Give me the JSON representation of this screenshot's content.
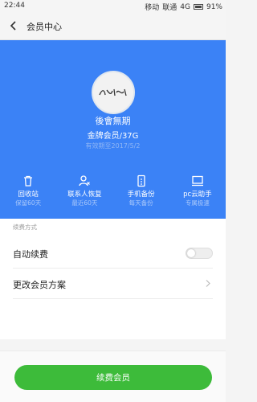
{
  "status_bar": {
    "time": "22:44",
    "carrier_1": "移动",
    "carrier_2": "联通",
    "network": "4G",
    "battery": "91%"
  },
  "nav": {
    "title": "会员中心",
    "back_icon": "chevron-left-icon"
  },
  "profile": {
    "avatar_text": "后会无期",
    "name": "後會無期",
    "level": "金牌会员/37G",
    "expire": "有效期至2017/5/2"
  },
  "features": [
    {
      "icon": "trash-icon",
      "label": "回收站",
      "sub": "保留60天"
    },
    {
      "icon": "contacts-icon",
      "label": "联系人恢复",
      "sub": "最近60天"
    },
    {
      "icon": "phone-backup-icon",
      "label": "手机备份",
      "sub": "每天备份"
    },
    {
      "icon": "pc-icon",
      "label": "pc云助手",
      "sub": "专属极速"
    }
  ],
  "settings": {
    "section_title": "续费方式",
    "auto_renew_label": "自动续费",
    "auto_renew_enabled": false,
    "change_plan_label": "更改会员方案"
  },
  "footer": {
    "renew_button": "续费会员"
  },
  "colors": {
    "hero": "#3b82f6",
    "button": "#3dbb3a"
  }
}
